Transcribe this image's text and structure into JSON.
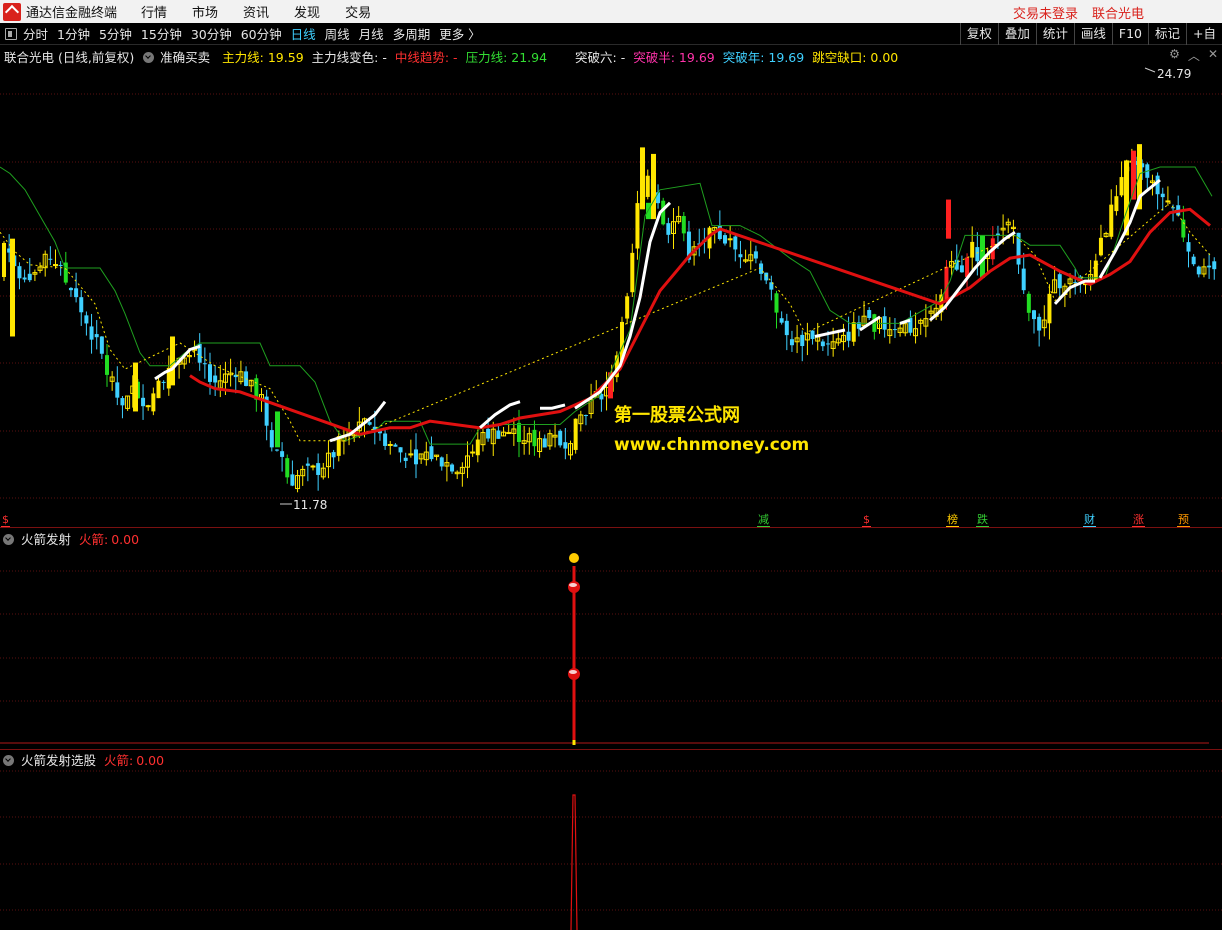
{
  "titlebar": {
    "app_name": "通达信金融终端",
    "menu": [
      "行情",
      "市场",
      "资讯",
      "发现",
      "交易"
    ],
    "login_status": "交易未登录",
    "stock_name": "联合光电"
  },
  "toolbar": {
    "periods": [
      "分时",
      "1分钟",
      "5分钟",
      "15分钟",
      "30分钟",
      "60分钟",
      "日线",
      "周线",
      "月线",
      "多周期",
      "更多 〉"
    ],
    "active_period": "日线",
    "tools": [
      "复权",
      "叠加",
      "统计",
      "画线",
      "F10",
      "标记",
      "+自"
    ]
  },
  "main_legend": {
    "title": "联合光电 (日线,前复权)",
    "indicator": "准确买卖",
    "items": [
      {
        "label": "主力线:",
        "value": "19.59",
        "color": "#ffe600"
      },
      {
        "label": "主力线变色:",
        "value": "-",
        "color": "#e6e6e6"
      },
      {
        "label": "中线趋势:",
        "value": "-",
        "color": "#ff3030"
      },
      {
        "label": "压力线:",
        "value": "21.94",
        "color": "#33dd33"
      },
      {
        "label": "突破六:",
        "value": "-",
        "color": "#e6e6e6"
      },
      {
        "label": "突破半:",
        "value": "19.69",
        "color": "#ff33aa"
      },
      {
        "label": "突破年:",
        "value": "19.69",
        "color": "#3fd0ff"
      },
      {
        "label": "跳空缺口:",
        "value": "0.00",
        "color": "#ffe600"
      }
    ],
    "icons": [
      "gear-icon",
      "chevron-up-icon",
      "close-icon"
    ]
  },
  "chart": {
    "high_label": "24.79",
    "low_label": "11.78",
    "watermark_cn": "第一股票公式网",
    "watermark_url": "www.chnmoney.com",
    "colors": {
      "up": "#ffe600",
      "down": "#3fd0ff",
      "strong_up": "#ff2020",
      "strong_down": "#22dd22",
      "main_line": "#ffffff",
      "trend_line": "#e01010",
      "pressure_line": "#1fa01f"
    },
    "event_tags": [
      {
        "text": "$",
        "color": "#ff3030"
      },
      {
        "text": "减",
        "color": "#33cc33"
      },
      {
        "text": "$",
        "color": "#ff3030"
      },
      {
        "text": "榜",
        "color": "#ffcc00"
      },
      {
        "text": "跌",
        "color": "#33cc33"
      },
      {
        "text": "财",
        "color": "#3fd0ff"
      },
      {
        "text": "涨",
        "color": "#ff3030"
      },
      {
        "text": "预",
        "color": "#ff9900"
      }
    ]
  },
  "panel1": {
    "title": "火箭发射",
    "label": "火箭:",
    "value": "0.00"
  },
  "panel2": {
    "title": "火箭发射选股",
    "label": "火箭:",
    "value": "0.00"
  }
}
